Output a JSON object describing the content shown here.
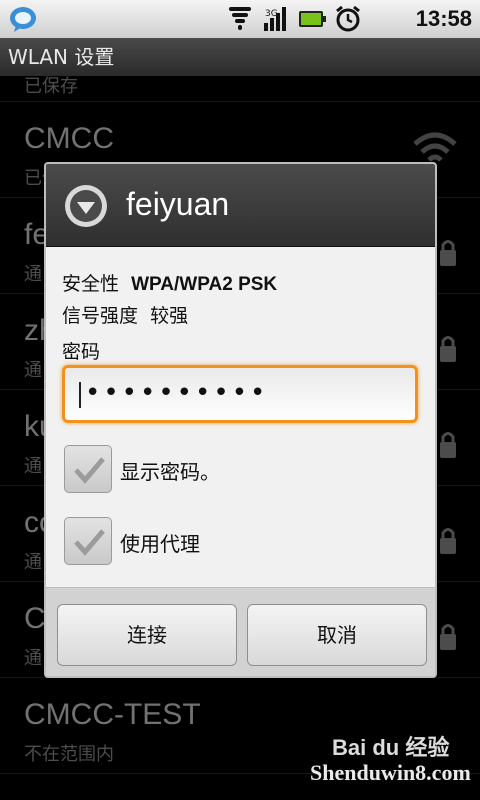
{
  "status_bar": {
    "time": "13:58",
    "icons": [
      "chat-bubble-icon",
      "wifi-icon",
      "signal-3g-icon",
      "battery-icon",
      "alarm-icon"
    ]
  },
  "title_bar": {
    "title": "WLAN 设置"
  },
  "networks": [
    {
      "ssid": "",
      "status": "已保存"
    },
    {
      "ssid": "CMCC",
      "status": "已保存"
    },
    {
      "ssid": "feiyuan",
      "status": "通"
    },
    {
      "ssid": "zh",
      "status": "通"
    },
    {
      "ssid": "ku",
      "status": "通"
    },
    {
      "ssid": "co",
      "status": "通"
    },
    {
      "ssid": "C",
      "status": "通"
    },
    {
      "ssid": "CMCC-TEST",
      "status": "不在范围内"
    }
  ],
  "dialog": {
    "title": "feiyuan",
    "security_label": "安全性",
    "security_value": "WPA/WPA2 PSK",
    "signal_label": "信号强度",
    "signal_value": "较强",
    "password_label": "密码",
    "password_value": "••••••••••",
    "show_password_label": "显示密码。",
    "show_password_checked": true,
    "use_proxy_label": "使用代理",
    "use_proxy_checked": true,
    "connect_label": "连接",
    "cancel_label": "取消"
  },
  "watermark": {
    "brand": "Bai du 经验",
    "site": "Shenduwin8.com"
  },
  "colors": {
    "focus": "#f0921d",
    "status_bar": "#e0e0e0",
    "check": "#9b9b9b"
  }
}
